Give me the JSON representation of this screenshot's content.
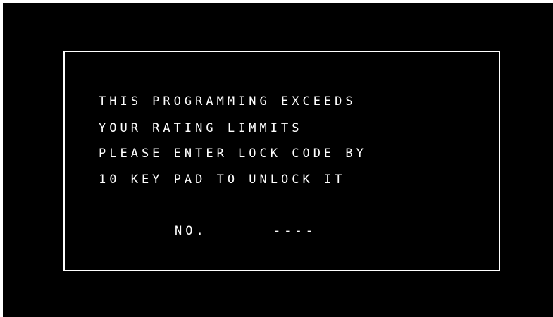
{
  "message": {
    "lines": [
      "THIS PROGRAMMING EXCEEDS",
      "YOUR RATING LIMMITS",
      "PLEASE ENTER LOCK CODE BY",
      "10 KEY PAD TO UNLOCK IT"
    ]
  },
  "lock_code": {
    "label": "NO.",
    "value": "----"
  },
  "colors": {
    "background": "#000000",
    "foreground": "#ffffff"
  }
}
